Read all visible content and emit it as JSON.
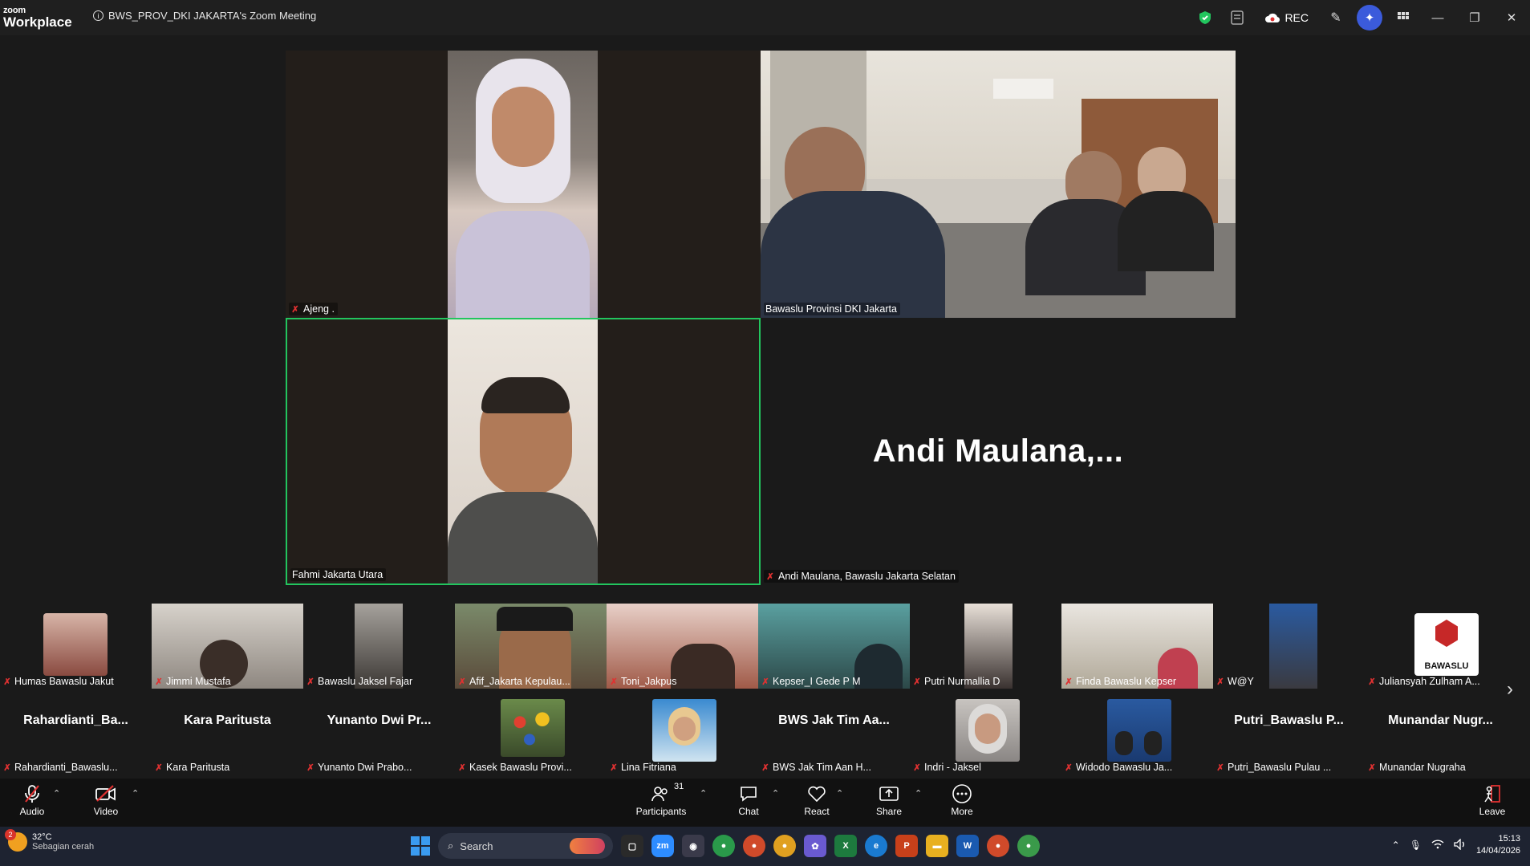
{
  "titlebar": {
    "logo_top": "zoom",
    "logo_bottom": "Workplace",
    "meeting_title": "BWS_PROV_DKI JAKARTA's Zoom Meeting",
    "rec_label": "REC"
  },
  "main_tiles": {
    "tile1_name": "Ajeng .",
    "tile2_name": "Bawaslu Provinsi DKI Jakarta",
    "tile3_name": "Fahmi Jakarta Utara",
    "tile4_big": "Andi  Maulana,...",
    "tile4_name": "Andi Maulana, Bawaslu Jakarta Selatan",
    "active_speaker_color": "#22c55e"
  },
  "strip_row1": [
    {
      "name": "Humas Bawaslu Jakut"
    },
    {
      "name": "Jimmi Mustafa"
    },
    {
      "name": "Bawaslu Jaksel Fajar"
    },
    {
      "name": "Afif_Jakarta Kepulau..."
    },
    {
      "name": "Toni_Jakpus"
    },
    {
      "name": "Kepser_I Gede P M"
    },
    {
      "name": "Putri Nurmallia D"
    },
    {
      "name": "Finda Bawaslu Kepser"
    },
    {
      "name": "W@Y"
    },
    {
      "name": "Juliansyah Zulham A...",
      "logo_text": "BAWASLU"
    }
  ],
  "strip_row2": [
    {
      "big": "Rahardianti_Ba...",
      "name": "Rahardianti_Bawaslu..."
    },
    {
      "big": "Kara Paritusta",
      "name": "Kara Paritusta"
    },
    {
      "big": "Yunanto Dwi Pr...",
      "name": "Yunanto Dwi Prabo..."
    },
    {
      "big": "",
      "name": "Kasek Bawaslu Provi..."
    },
    {
      "big": "",
      "name": "Lina Fitriana"
    },
    {
      "big": "BWS Jak Tim Aa...",
      "name": "BWS Jak Tim Aan H..."
    },
    {
      "big": "",
      "name": "Indri - Jaksel"
    },
    {
      "big": "",
      "name": "Widodo Bawaslu Ja..."
    },
    {
      "big": "Putri_Bawaslu P...",
      "name": "Putri_Bawaslu Pulau ..."
    },
    {
      "big": "Munandar  Nugr...",
      "name": "Munandar Nugraha"
    }
  ],
  "toolbar": {
    "audio": "Audio",
    "video": "Video",
    "participants": "Participants",
    "participants_count": "31",
    "chat": "Chat",
    "react": "React",
    "share": "Share",
    "more": "More",
    "leave": "Leave"
  },
  "taskbar": {
    "weather_badge": "2",
    "temperature": "32°C",
    "condition": "Sebagian cerah",
    "search_placeholder": "Search",
    "time": "15:13",
    "date": "14/04/2026"
  }
}
